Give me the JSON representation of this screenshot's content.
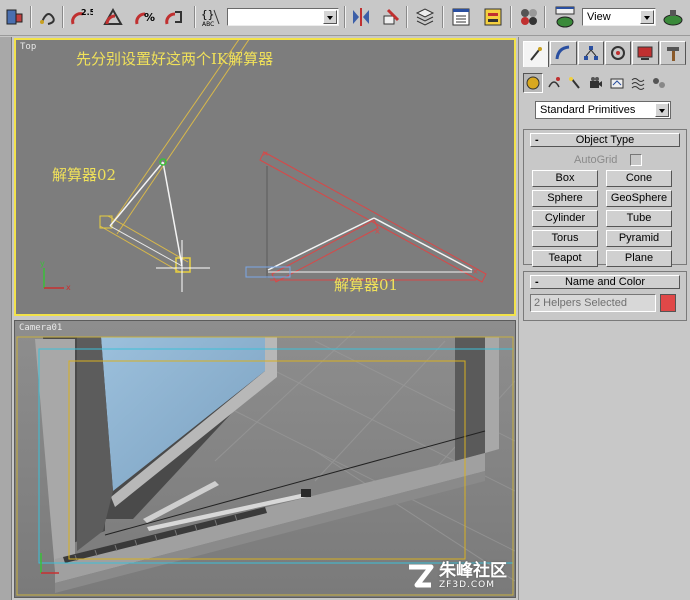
{
  "toolbar": {
    "selection_set_value": "",
    "view_value": "View"
  },
  "viewports": {
    "top": {
      "label": "Top",
      "annotation_main": "先分别设置好这两个IK解算器",
      "solver_left": "解算器02",
      "solver_right": "解算器01"
    },
    "camera": {
      "label": "Camera01"
    }
  },
  "command_panel": {
    "category_value": "Standard Primitives",
    "object_type": {
      "title": "Object Type",
      "autogrid_label": "AutoGrid",
      "buttons": [
        "Box",
        "Cone",
        "Sphere",
        "GeoSphere",
        "Cylinder",
        "Tube",
        "Torus",
        "Pyramid",
        "Teapot",
        "Plane"
      ]
    },
    "name_and_color": {
      "title": "Name and Color",
      "name_value": "2 Helpers Selected",
      "color": "#e04848"
    }
  },
  "watermark": {
    "title": "朱峰社区",
    "subtitle": "ZF3D.COM"
  }
}
